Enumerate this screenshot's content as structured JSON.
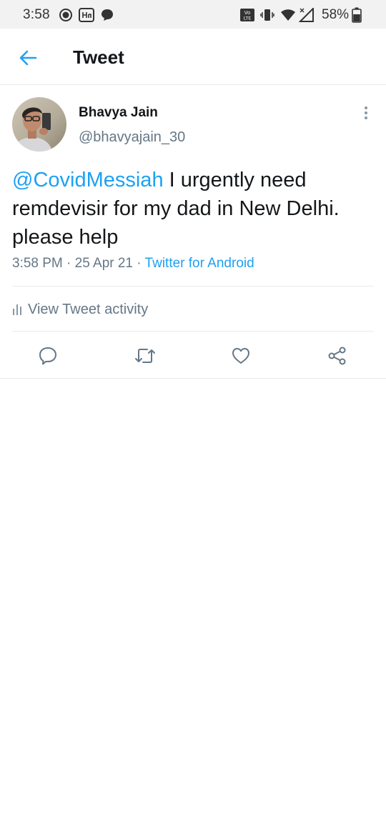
{
  "status_bar": {
    "time": "3:58",
    "battery_percent": "58%",
    "icons": [
      "record-icon",
      "app-notification-icon",
      "message-icon",
      "volte-icon",
      "vibrate-icon",
      "wifi-icon",
      "signal-icon",
      "battery-icon"
    ]
  },
  "app_bar": {
    "title": "Tweet",
    "back_icon": "back-arrow-icon"
  },
  "tweet": {
    "author_name": "Bhavya Jain",
    "author_handle": "@bhavyajain_30",
    "mention": "@CovidMessiah",
    "text_line1": " I urgently need",
    "text_line2": "remdevisir for my dad in New Delhi.",
    "text_line3": "please help",
    "time": "3:58 PM",
    "separator": " · ",
    "date": "25 Apr 21",
    "source": "Twitter for Android"
  },
  "activity": {
    "label": "View Tweet activity",
    "icon": "bar-chart-icon"
  },
  "actions": {
    "icons": [
      "reply-icon",
      "retweet-icon",
      "like-icon",
      "share-icon"
    ]
  },
  "colors": {
    "accent": "#1da1f2",
    "secondary_text": "#657786",
    "primary_text": "#14171a",
    "divider": "#e6ecf0",
    "status_bar_bg": "#f2f2f2"
  }
}
